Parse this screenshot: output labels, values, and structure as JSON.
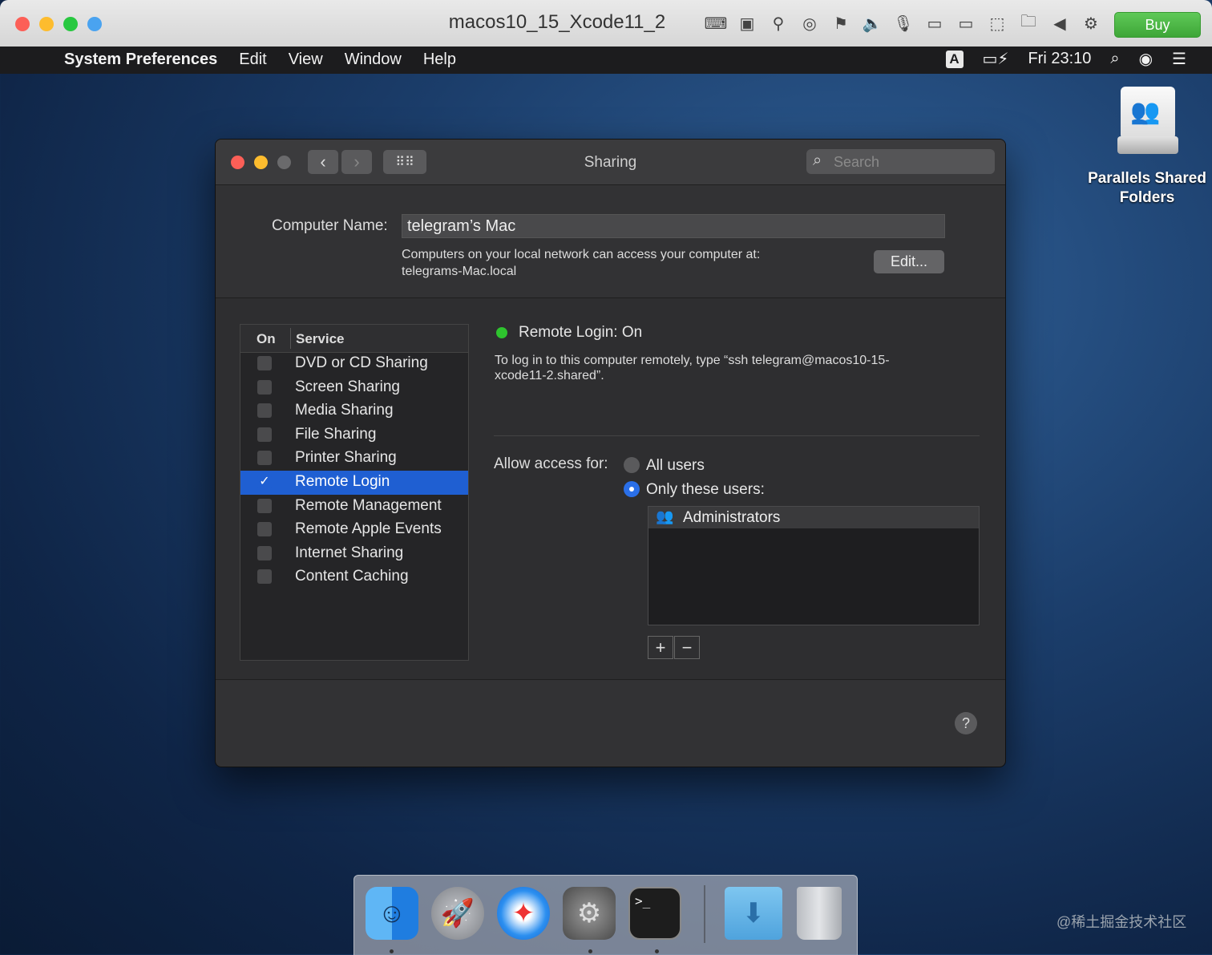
{
  "host": {
    "title": "macos10_15_Xcode11_2",
    "buy_label": "Buy",
    "traffic_colors": [
      "#fc5f57",
      "#fdbc2e",
      "#28c840",
      "#4aa3f0"
    ],
    "toolbar_icons": [
      "keyboard-icon",
      "cpu-icon",
      "usb-icon",
      "cd-icon",
      "network-icon",
      "speaker-icon",
      "microphone-icon",
      "device-icon",
      "device2-icon",
      "camera-icon",
      "folder-share-icon",
      "arrow-left-icon",
      "gear-icon"
    ]
  },
  "menubar": {
    "app_name": "System Preferences",
    "items": [
      "Edit",
      "View",
      "Window",
      "Help"
    ],
    "input_source": "A",
    "clock": "Fri 23:10"
  },
  "desktop": {
    "drive_label": "Parallels Shared Folders"
  },
  "window": {
    "title": "Sharing",
    "search_placeholder": "Search",
    "computer_name_label": "Computer Name:",
    "computer_name_value": "telegram’s Mac",
    "local_info_line1": "Computers on your local network can access your computer at:",
    "local_info_line2": "telegrams-Mac.local",
    "edit_button": "Edit...",
    "services_header": {
      "on": "On",
      "service": "Service"
    },
    "services": [
      {
        "label": "DVD or CD Sharing",
        "checked": false
      },
      {
        "label": "Screen Sharing",
        "checked": false
      },
      {
        "label": "Media Sharing",
        "checked": false
      },
      {
        "label": "File Sharing",
        "checked": false
      },
      {
        "label": "Printer Sharing",
        "checked": false
      },
      {
        "label": "Remote Login",
        "checked": true,
        "selected": true
      },
      {
        "label": "Remote Management",
        "checked": false
      },
      {
        "label": "Remote Apple Events",
        "checked": false
      },
      {
        "label": "Internet Sharing",
        "checked": false
      },
      {
        "label": "Content Caching",
        "checked": false
      }
    ],
    "status_text": "Remote Login: On",
    "status_color": "#2ec42e",
    "instructions_line1": "To log in to this computer remotely, type “ssh telegram@macos10-15-",
    "instructions_line2": "xcode11-2.shared”.",
    "allow_label": "Allow access for:",
    "radio_all": "All users",
    "radio_only": "Only these users:",
    "selected_radio": "only",
    "users": [
      "Administrators"
    ],
    "add_label": "+",
    "remove_label": "−",
    "help_label": "?",
    "accent_color": "#1f5fd2"
  },
  "dock": {
    "apps": [
      "finder-icon",
      "launchpad-icon",
      "safari-icon",
      "system-preferences-icon",
      "terminal-icon",
      "downloads-folder-icon",
      "trash-icon"
    ],
    "terminal_prompt": ">_"
  },
  "watermark": "@稀土掘金技术社区"
}
